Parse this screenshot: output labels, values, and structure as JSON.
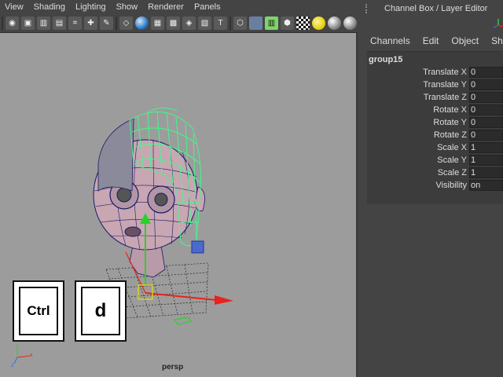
{
  "viewport": {
    "menu": [
      "View",
      "Shading",
      "Lighting",
      "Show",
      "Renderer",
      "Panels"
    ],
    "camera": "persp"
  },
  "keys": {
    "ctrl": "Ctrl",
    "d": "d"
  },
  "channel_box": {
    "title": "Channel Box / Layer Editor",
    "menus": [
      "Channels",
      "Edit",
      "Object",
      "Show"
    ],
    "object": "group15",
    "attributes": [
      {
        "label": "Translate X",
        "value": "0"
      },
      {
        "label": "Translate Y",
        "value": "0"
      },
      {
        "label": "Translate Z",
        "value": "0"
      },
      {
        "label": "Rotate X",
        "value": "0"
      },
      {
        "label": "Rotate Y",
        "value": "0"
      },
      {
        "label": "Rotate Z",
        "value": "0"
      },
      {
        "label": "Scale X",
        "value": "1"
      },
      {
        "label": "Scale Y",
        "value": "1"
      },
      {
        "label": "Scale Z",
        "value": "1"
      },
      {
        "label": "Visibility",
        "value": "on"
      }
    ]
  },
  "colors": {
    "viewport_bg": "#9c9c9c",
    "wire_selected": "#3cff8a",
    "wire_default": "#1a1a66",
    "axis_x": "#e8231c",
    "axis_y": "#2ad12a"
  }
}
